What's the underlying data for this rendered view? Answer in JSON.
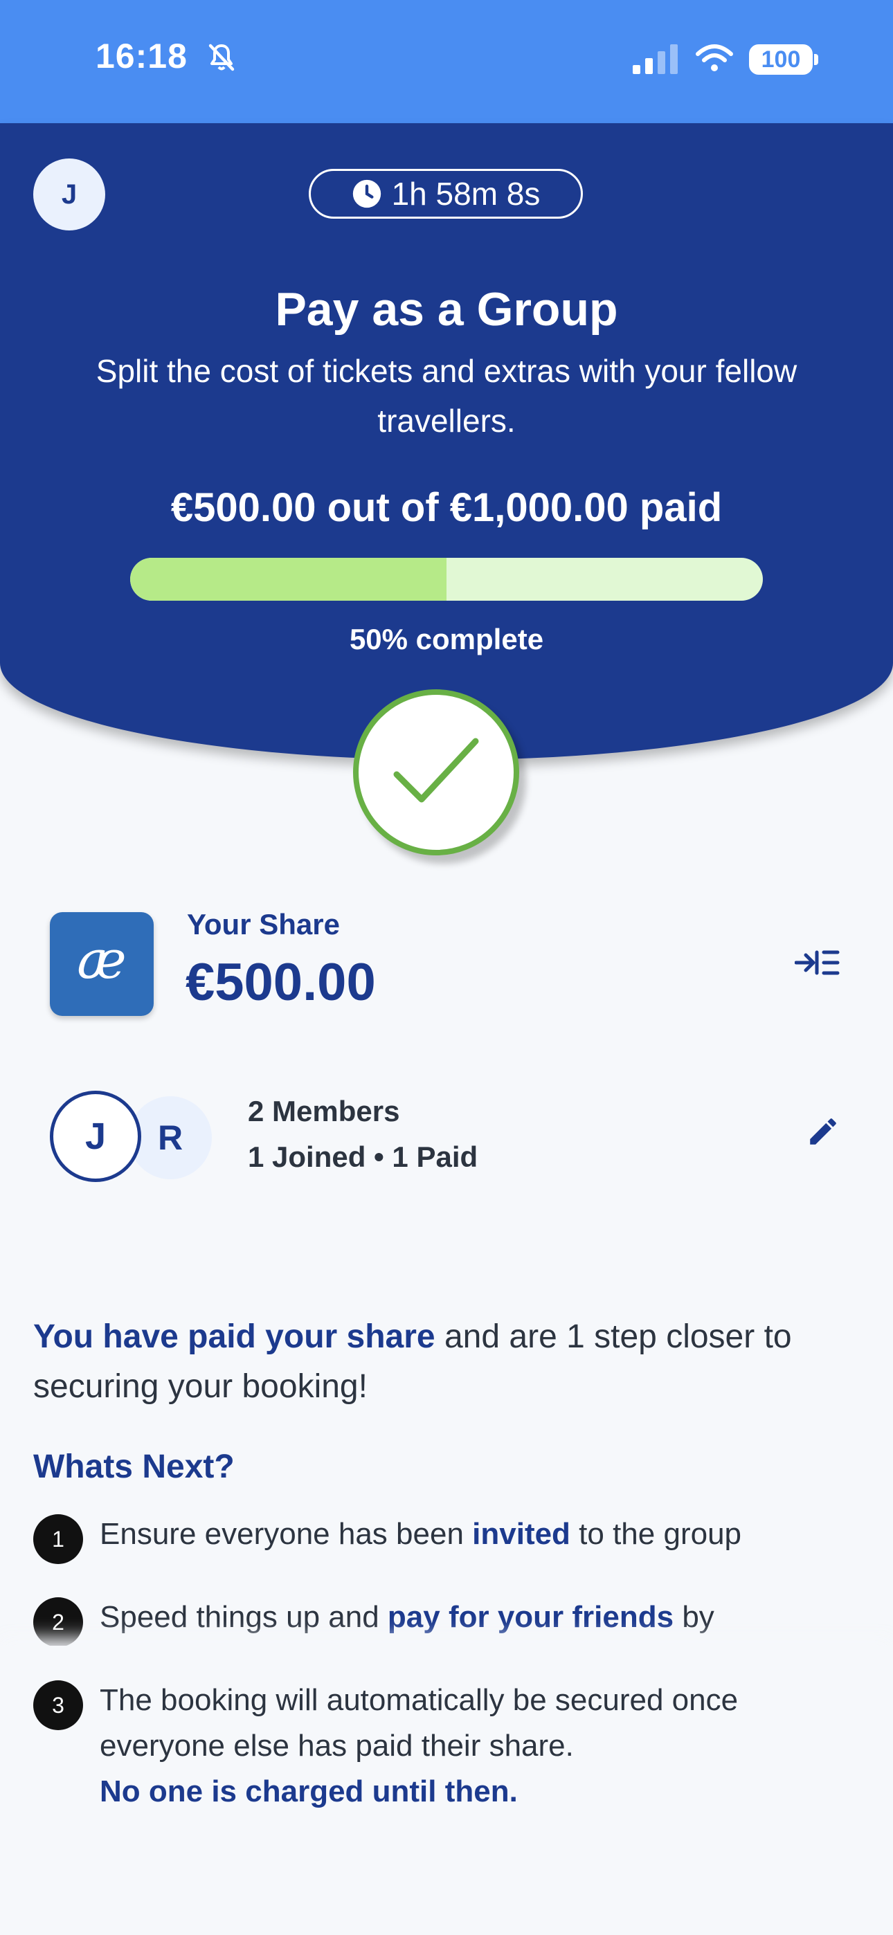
{
  "status_bar": {
    "time": "16:18",
    "battery": "100",
    "icons": [
      "bell-slash-icon",
      "signal-icon",
      "wifi-icon",
      "battery-icon"
    ]
  },
  "header": {
    "avatar_initial": "J",
    "timer": "1h 58m 8s",
    "title": "Pay as a Group",
    "subtitle": "Split the cost of tickets and extras with your fellow travellers.",
    "paid_summary": "€500.00 out of €1,000.00 paid",
    "progress_fraction": 0.5,
    "progress_label": "50% complete"
  },
  "share": {
    "brand": "æ",
    "label": "Your Share",
    "amount": "€500.00"
  },
  "members": {
    "initials": [
      "J",
      "R"
    ],
    "count_text": "2 Members",
    "status_text": "1 Joined • 1 Paid"
  },
  "message": {
    "highlight": "You have paid your share",
    "rest": " and are 1 step closer to securing your booking!"
  },
  "next": {
    "heading": "Whats Next?",
    "steps": [
      {
        "number": "1",
        "before": "Ensure everyone has been ",
        "highlight": "invited",
        "after": " to the group"
      },
      {
        "number": "2",
        "before": "Speed things up and ",
        "highlight": "pay for your friends",
        "after": " by"
      },
      {
        "number": "3",
        "before": "The booking will automatically be secured once everyone else has paid their share.",
        "highlight": "No one is charged until then.",
        "after": ""
      }
    ]
  },
  "colors": {
    "status_bar": "#4a8df2",
    "brand_navy": "#1c3a8e",
    "progress_fill": "#b6ea88",
    "progress_track": "#e1f8d4",
    "check_green": "#68b045",
    "logo_blue": "#2f6db8"
  }
}
